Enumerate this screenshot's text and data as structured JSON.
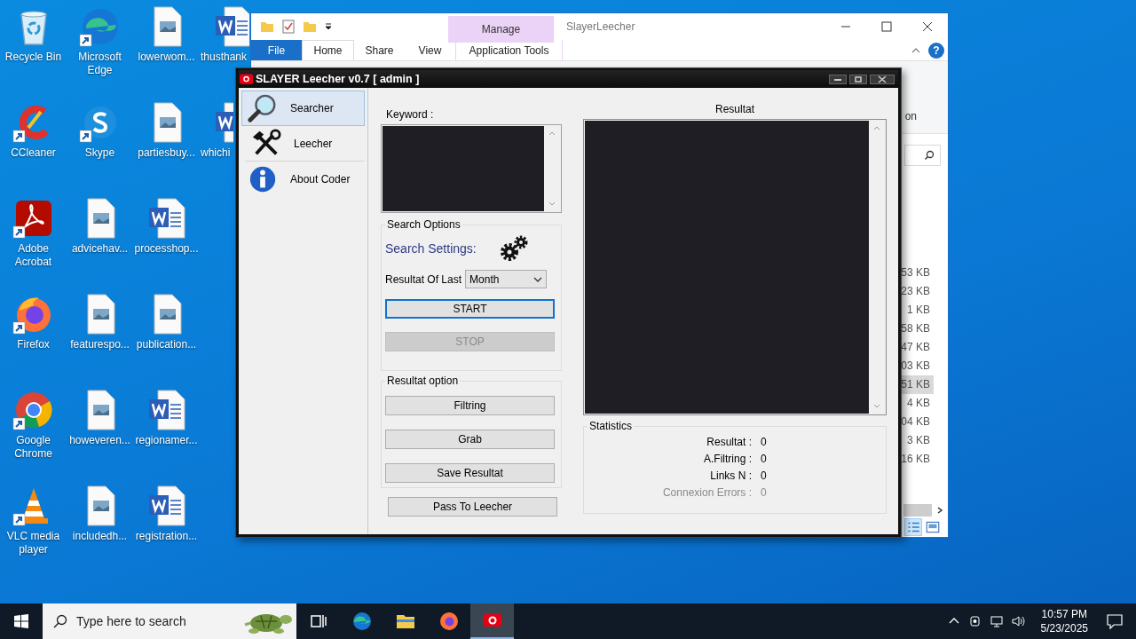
{
  "desktop_icons": [
    {
      "label": "Recycle Bin",
      "kind": "recycle",
      "shortcut": false
    },
    {
      "label": "CCleaner",
      "kind": "ccleaner",
      "shortcut": true
    },
    {
      "label": "Adobe Acrobat",
      "kind": "acrobat",
      "shortcut": true
    },
    {
      "label": "Firefox",
      "kind": "firefox",
      "shortcut": true
    },
    {
      "label": "Google Chrome",
      "kind": "chrome",
      "shortcut": true
    },
    {
      "label": "VLC media player",
      "kind": "vlc",
      "shortcut": true
    },
    {
      "label": "Microsoft Edge",
      "kind": "edge",
      "shortcut": true
    },
    {
      "label": "Skype",
      "kind": "skype",
      "shortcut": true
    },
    {
      "label": "advicehav...",
      "kind": "image",
      "shortcut": false
    },
    {
      "label": "featurespo...",
      "kind": "image",
      "shortcut": false
    },
    {
      "label": "howeveren...",
      "kind": "image",
      "shortcut": false
    },
    {
      "label": "includedh...",
      "kind": "image",
      "shortcut": false
    },
    {
      "label": "lowerwom...",
      "kind": "image",
      "shortcut": false
    },
    {
      "label": "partiesbuy...",
      "kind": "image",
      "shortcut": false
    },
    {
      "label": "processhop...",
      "kind": "word",
      "shortcut": false
    },
    {
      "label": "publication...",
      "kind": "image",
      "shortcut": false
    },
    {
      "label": "regionamer...",
      "kind": "word",
      "shortcut": false
    },
    {
      "label": "registration...",
      "kind": "word",
      "shortcut": false
    },
    {
      "label": "thusthank",
      "kind": "word",
      "shortcut": false
    },
    {
      "label": "whichi",
      "kind": "word",
      "shortcut": false
    }
  ],
  "explorer": {
    "title": "SlayerLeecher",
    "context_tab": "Manage",
    "help": "?",
    "tabs": [
      {
        "label": "File",
        "kind": "file",
        "selected": false
      },
      {
        "label": "Home",
        "kind": "tab",
        "selected": true
      },
      {
        "label": "Share",
        "kind": "tab",
        "selected": false
      },
      {
        "label": "View",
        "kind": "tab",
        "selected": false
      },
      {
        "label": "Application Tools",
        "kind": "context",
        "selected": false
      }
    ],
    "ribbon_text": "on",
    "sizes": [
      {
        "text": "53 KB",
        "selected": false
      },
      {
        "text": "23 KB",
        "selected": false
      },
      {
        "text": "1 KB",
        "selected": false
      },
      {
        "text": "58 KB",
        "selected": false
      },
      {
        "text": "47 KB",
        "selected": false
      },
      {
        "text": "03 KB",
        "selected": false
      },
      {
        "text": "51 KB",
        "selected": true
      },
      {
        "text": "4 KB",
        "selected": false
      },
      {
        "text": "04 KB",
        "selected": false
      },
      {
        "text": "3 KB",
        "selected": false
      },
      {
        "text": "16 KB",
        "selected": false
      }
    ],
    "views": [
      {
        "kind": "details",
        "selected": true
      },
      {
        "kind": "thumbnails",
        "selected": false
      }
    ]
  },
  "app": {
    "title": "SLAYER Leecher v0.7 [ admin ]",
    "nav": [
      {
        "label": "Searcher",
        "kind": "search",
        "selected": true
      },
      {
        "label": "Leecher",
        "kind": "tools",
        "selected": false
      },
      {
        "label": "About Coder",
        "kind": "info",
        "selected": false
      }
    ],
    "keyword_label": "Keyword :",
    "search_options": {
      "title": "Search Options",
      "settings_label": "Search Settings:",
      "period_label": "Resultat Of Last",
      "period": "Month",
      "buttons": [
        {
          "label": "START",
          "focused": true,
          "disabled": false
        },
        {
          "label": "STOP",
          "focused": false,
          "disabled": true
        }
      ]
    },
    "result_option": {
      "title": "Resultat option",
      "buttons": [
        "Filtring",
        "Grab",
        "Save Resultat"
      ]
    },
    "pass_button": "Pass To Leecher",
    "results_title": "Resultat",
    "statistics": {
      "title": "Statistics",
      "rows": [
        {
          "label": "Resultat :",
          "value": "0",
          "disabled": false
        },
        {
          "label": "A.Filtring :",
          "value": "0",
          "disabled": false
        },
        {
          "label": "Links N :",
          "value": "0",
          "disabled": false
        },
        {
          "label": "Connexion Errors :",
          "value": "0",
          "disabled": true
        }
      ]
    }
  },
  "taskbar": {
    "search_placeholder": "Type here to search",
    "apps": [
      {
        "kind": "taskview",
        "selected": false
      },
      {
        "kind": "edge",
        "selected": false
      },
      {
        "kind": "explorer",
        "selected": false
      },
      {
        "kind": "firefox",
        "selected": false
      },
      {
        "kind": "slayer",
        "selected": true
      }
    ],
    "time": "10:57 PM",
    "date": "5/23/2025"
  }
}
